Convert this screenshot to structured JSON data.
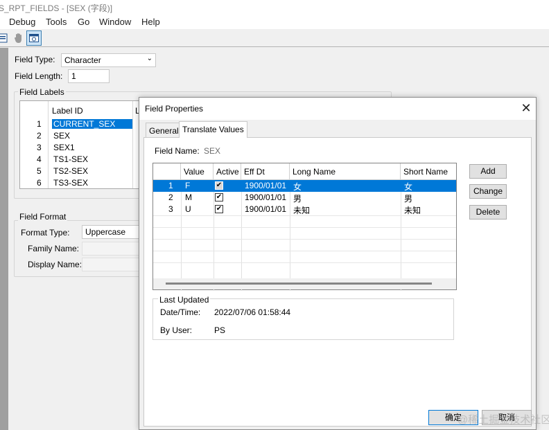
{
  "window": {
    "title": "PS_RPT_FIELDS - [SEX (字段)]"
  },
  "menu": {
    "items": [
      "Debug",
      "Tools",
      "Go",
      "Window",
      "Help"
    ]
  },
  "toolbar": {
    "icons": [
      "properties-icon",
      "hand-icon",
      "window-icon"
    ]
  },
  "main": {
    "field_type_label": "Field Type:",
    "field_type_value": "Character",
    "field_length_label": "Field Length:",
    "field_length_value": "1",
    "field_labels_title": "Field Labels",
    "label_grid": {
      "header_label_id": "Label ID",
      "header_l": "L",
      "rows": [
        {
          "num": "1",
          "id": "CURRENT_SEX"
        },
        {
          "num": "2",
          "id": "SEX"
        },
        {
          "num": "3",
          "id": "SEX1"
        },
        {
          "num": "4",
          "id": "TS1-SEX"
        },
        {
          "num": "5",
          "id": "TS2-SEX"
        },
        {
          "num": "6",
          "id": "TS3-SEX"
        }
      ]
    },
    "field_format_title": "Field Format",
    "format_type_label": "Format Type:",
    "format_type_value": "Uppercase",
    "family_name_label": "Family Name:",
    "display_name_label": "Display Name:"
  },
  "dialog": {
    "title": "Field Properties",
    "close_glyph": "✕",
    "tabs": [
      "General",
      "Translate Values"
    ],
    "active_tab": "Translate Values",
    "field_name_label": "Field Name:",
    "field_name_value": "SEX",
    "grid": {
      "headers": [
        "Value",
        "Active",
        "Eff Dt",
        "Long Name",
        "Short Name"
      ],
      "rows": [
        {
          "num": "1",
          "value": "F",
          "active": "✔",
          "eff_dt": "1900/01/01",
          "long_name": "女",
          "short_name": "女",
          "selected": true
        },
        {
          "num": "2",
          "value": "M",
          "active": "✔",
          "eff_dt": "1900/01/01",
          "long_name": "男",
          "short_name": "男",
          "selected": false
        },
        {
          "num": "3",
          "value": "U",
          "active": "✔",
          "eff_dt": "1900/01/01",
          "long_name": "未知",
          "short_name": "未知",
          "selected": false
        }
      ]
    },
    "buttons": {
      "add": "Add",
      "change": "Change",
      "delete": "Delete"
    },
    "last_updated": {
      "title": "Last Updated",
      "datetime_label": "Date/Time:",
      "datetime_value": "2022/07/06 01:58:44",
      "user_label": "By User:",
      "user_value": "PS"
    },
    "footer": {
      "ok": "确定",
      "cancel": "取消"
    }
  },
  "watermark": "@稀土掘金技术社区",
  "colors": {
    "selection": "#0078d7",
    "dialog_bg": "#f0f0f0",
    "panel_bg": "#ffffff",
    "ok_border": "#0078d7"
  }
}
